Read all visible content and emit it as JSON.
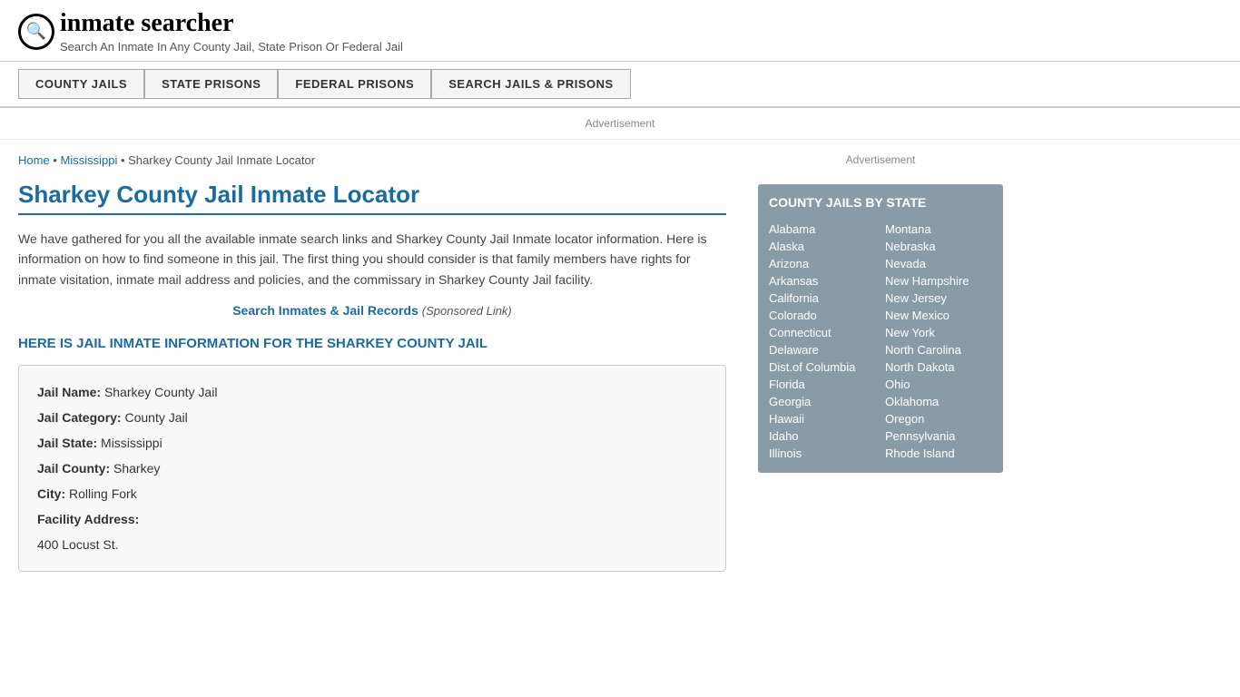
{
  "header": {
    "logo_icon": "🔍",
    "logo_text": "inmate searcher",
    "tagline": "Search An Inmate In Any County Jail, State Prison Or Federal Jail"
  },
  "nav": {
    "buttons": [
      {
        "label": "COUNTY JAILS",
        "id": "county-jails-nav"
      },
      {
        "label": "STATE PRISONS",
        "id": "state-prisons-nav"
      },
      {
        "label": "FEDERAL PRISONS",
        "id": "federal-prisons-nav"
      },
      {
        "label": "SEARCH JAILS & PRISONS",
        "id": "search-nav"
      }
    ]
  },
  "ad_banner": "Advertisement",
  "breadcrumb": {
    "home": "Home",
    "state": "Mississippi",
    "current": "Sharkey County Jail Inmate Locator"
  },
  "page_title": "Sharkey County Jail Inmate Locator",
  "description": "We have gathered for you all the available inmate search links and Sharkey County Jail Inmate locator information. Here is information on how to find someone in this jail. The first thing you should consider is that family members have rights for inmate visitation, inmate mail address and policies, and the commissary in Sharkey County Jail facility.",
  "sponsored": {
    "link_text": "Search Inmates & Jail Records",
    "suffix": "(Sponsored Link)"
  },
  "info_heading": "HERE IS JAIL INMATE INFORMATION FOR THE SHARKEY COUNTY JAIL",
  "jail_info": {
    "name_label": "Jail Name:",
    "name_value": "Sharkey County Jail",
    "category_label": "Jail Category:",
    "category_value": "County Jail",
    "state_label": "Jail State:",
    "state_value": "Mississippi",
    "county_label": "Jail County:",
    "county_value": "Sharkey",
    "city_label": "City:",
    "city_value": "Rolling Fork",
    "address_label": "Facility Address:",
    "address_value": "400 Locust St."
  },
  "sidebar": {
    "ad_label": "Advertisement",
    "county_jails_title": "COUNTY JAILS BY STATE",
    "states_left": [
      "Alabama",
      "Alaska",
      "Arizona",
      "Arkansas",
      "California",
      "Colorado",
      "Connecticut",
      "Delaware",
      "Dist.of Columbia",
      "Florida",
      "Georgia",
      "Hawaii",
      "Idaho",
      "Illinois"
    ],
    "states_right": [
      "Montana",
      "Nebraska",
      "Nevada",
      "New Hampshire",
      "New Jersey",
      "New Mexico",
      "New York",
      "North Carolina",
      "North Dakota",
      "Ohio",
      "Oklahoma",
      "Oregon",
      "Pennsylvania",
      "Rhode Island"
    ]
  }
}
